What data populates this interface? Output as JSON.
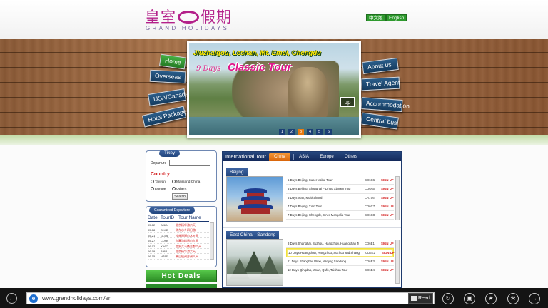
{
  "header": {
    "logo_cn_left": "皇室",
    "logo_cn_right": "假期",
    "logo_en": "GRAND HOLIDAYS",
    "lang_cn": "中文版",
    "lang_en": "English"
  },
  "nav": {
    "home": "Home",
    "overseas": "Overseas",
    "usa_canada": "USA/Canada",
    "hotel_package": "Hotel Package",
    "about_us": "About us",
    "travel_agent": "Travel Agent",
    "accommodation": "Accommodation",
    "central_bus": "Central bus"
  },
  "banner": {
    "subtitle": "Jiuzhaigou, Leshan, Mt. Emei, Chengdu",
    "days": "9 Days",
    "title": "Classic Tour",
    "up_label": "up",
    "pages": [
      "1",
      "2",
      "3",
      "4",
      "5",
      "6"
    ],
    "active_page": 2
  },
  "search": {
    "title": "Tikey",
    "departure_label": "Departure",
    "departure_value": "",
    "country_label": "Country",
    "options": [
      "Taiwan",
      "Mainland China",
      "Europe",
      "Others"
    ],
    "button": "Search"
  },
  "departures": {
    "title": "Guaranteed Departure",
    "headers": [
      "Date",
      "TourID",
      "Tour Name"
    ],
    "rows": [
      [
        "05-12",
        "BJ6A",
        "北京精华游六天"
      ],
      [
        "05-18",
        "SH4D",
        "华东水乡四日游"
      ],
      [
        "05-21",
        "GL5A",
        "桂林阳朔山水五天"
      ],
      [
        "05-27",
        "CD9B",
        "九寨沟峨眉山九天"
      ],
      [
        "06-02",
        "XA6C",
        "西安兵马俑古都六天"
      ],
      [
        "06-09",
        "BJ6A",
        "北京精华游六天"
      ],
      [
        "06-15",
        "HZ8E",
        "黄山杭州苏州八天"
      ]
    ]
  },
  "hot_deals": "Hot Deals",
  "tours": {
    "section_title": "International Tour",
    "tabs": [
      "China",
      "ASIA",
      "Europe",
      "Others"
    ],
    "active_tab": 0,
    "beijing": {
      "title": "Beijing",
      "items": [
        {
          "name": "5 Days Beijing, Super Value Tour",
          "code": "CD6C6",
          "signup": "SIGN UP"
        },
        {
          "name": "5 Days Beijing, Shanghai Fuzhou Xiamen Tour",
          "code": "CD6A6",
          "signup": "SIGN UP"
        },
        {
          "name": "6 Days Xian, Multicultural",
          "code": "CA1V6",
          "signup": "SIGN UP"
        },
        {
          "name": "7 Days Beijing, Xian Tour",
          "code": "CD6C7",
          "signup": "SIGN UP"
        },
        {
          "name": "7 Days Beijing, Chengde, Inner Mongolia Tour",
          "code": "CD6C8",
          "signup": "SIGN UP"
        }
      ]
    },
    "east": {
      "title": "East China　Sandong",
      "items": [
        {
          "name": "8 Days Shanghai, Suzhou, Hangzhou, Huangshan Tour",
          "code": "CD6E1",
          "signup": "SIGN UP"
        },
        {
          "name": "10 Days Huangshan, Hangzhou, Suzhou and Shanghai",
          "code": "CD6E2",
          "signup": "SIGN UP"
        },
        {
          "name": "11 Days Shanghai, Wuxi, Nanjing Sandong",
          "code": "CD6E3",
          "signup": "SIGN UP"
        },
        {
          "name": "12 Days Qingdao, Jinan, Qufu, Taishan Tour",
          "code": "CD6E4",
          "signup": "SIGN UP"
        }
      ]
    }
  },
  "browser": {
    "url": "www.grandholidays.com/en",
    "read_label": "Read",
    "back_icon": "←",
    "refresh_icon": "↻",
    "tabs_icon": "▣",
    "fav_icon": "★",
    "tools_icon": "⚒",
    "forward_icon": "→"
  }
}
